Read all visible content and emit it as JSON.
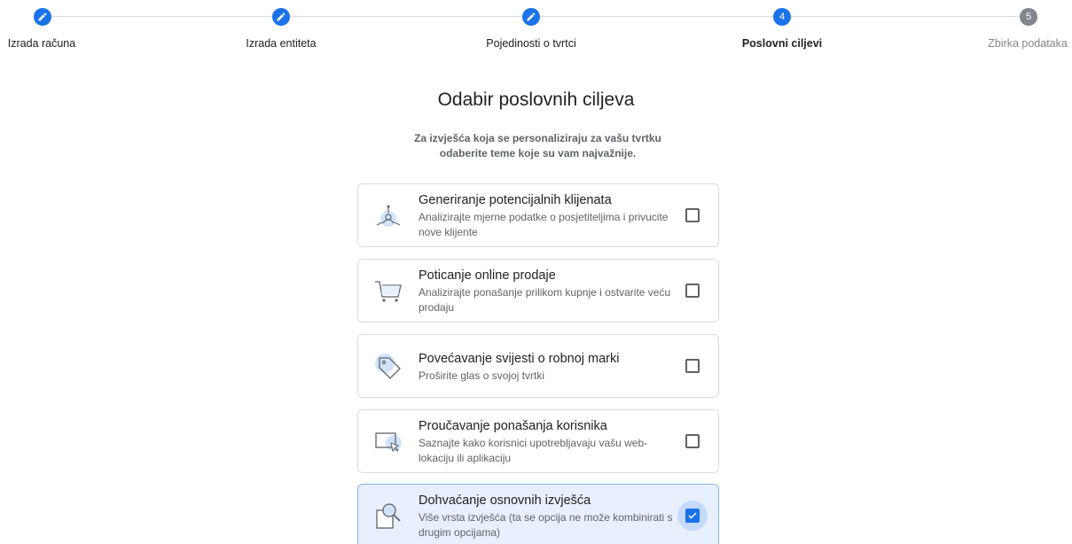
{
  "stepper": {
    "steps": [
      {
        "label": "Izrada računa",
        "state": "done",
        "icon": "pencil-icon"
      },
      {
        "label": "Izrada entiteta",
        "state": "done",
        "icon": "pencil-icon"
      },
      {
        "label": "Pojedinosti o tvrtci",
        "state": "done",
        "icon": "pencil-icon"
      },
      {
        "label": "Poslovni ciljevi",
        "state": "current",
        "number": "4"
      },
      {
        "label": "Zbirka podataka",
        "state": "todo",
        "number": "5"
      }
    ]
  },
  "header": {
    "title": "Odabir poslovnih ciljeva",
    "subtitle": "Za izvješća koja se personaliziraju za vašu tvrtku odaberite teme koje su vam najvažnije."
  },
  "options": [
    {
      "title": "Generiranje potencijalnih klijenata",
      "description": "Analizirajte mjerne podatke o posjetiteljima i privucite nove klijente",
      "icon": "leads-icon",
      "checked": false
    },
    {
      "title": "Poticanje online prodaje",
      "description": "Analizirajte ponašanje prilikom kupnje i ostvarite veću prodaju",
      "icon": "cart-icon",
      "checked": false
    },
    {
      "title": "Povećavanje svijesti o robnoj marki",
      "description": "Proširite glas o svojoj tvrtki",
      "icon": "tag-icon",
      "checked": false
    },
    {
      "title": "Proučavanje ponašanja korisnika",
      "description": "Saznajte kako korisnici upotrebljavaju vašu web-lokaciju ili aplikaciju",
      "icon": "screen-cursor-icon",
      "checked": false
    },
    {
      "title": "Dohvaćanje osnovnih izvješća",
      "description": "Više vrsta izvješća (ta se opcija ne može kombinirati s drugim opcijama)",
      "icon": "report-search-icon",
      "checked": true
    }
  ],
  "colors": {
    "accent": "#1a73e8",
    "selected_bg": "#e8f0fe",
    "muted": "#80868b"
  }
}
